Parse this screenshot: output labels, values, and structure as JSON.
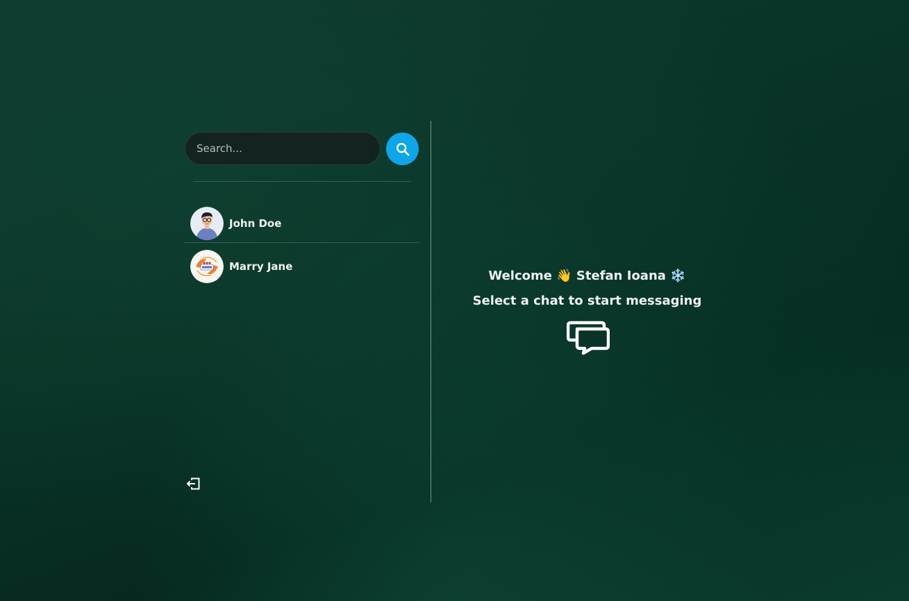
{
  "search": {
    "placeholder": "Search...",
    "button_icon": "search-icon"
  },
  "conversations": [
    {
      "name": "John Doe",
      "avatar_icon": "avatar-man-illustration"
    },
    {
      "name": "Marry Jane",
      "avatar_icon": "avatar-logo-illustration"
    }
  ],
  "sidebar": {
    "logout_icon": "logout-icon"
  },
  "main": {
    "welcome_line": "Welcome 👋 Stefan Ioana ❄️",
    "subtitle": "Select a chat to start messaging",
    "chat_icon": "chat-bubbles-icon"
  },
  "colors": {
    "accent": "#0ea5e9",
    "background": "#0a3327",
    "text": "#eef2f0"
  }
}
